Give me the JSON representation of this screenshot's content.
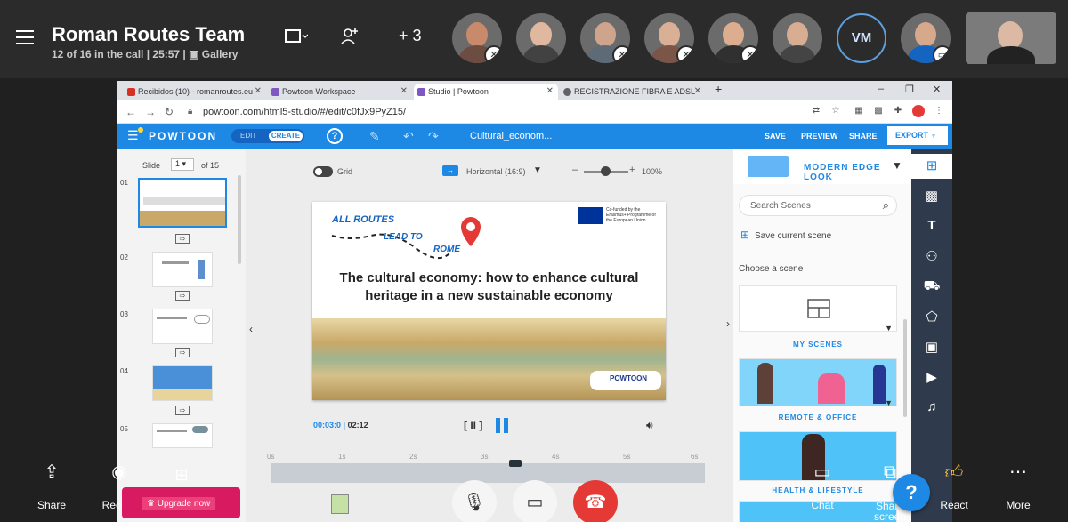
{
  "call": {
    "title": "Roman Routes Team",
    "info": "12 of 16 in the call | 25:57 | ▣ Gallery",
    "extra_participants": "+ 3",
    "initials_avatar": "VM"
  },
  "browser": {
    "tabs": [
      {
        "label": "Recibidos (10) - romanroutes.eu",
        "icon_color": "#d93025"
      },
      {
        "label": "Powtoon Workspace",
        "icon_color": "#7e57c2"
      },
      {
        "label": "Studio | Powtoon",
        "icon_color": "#7e57c2"
      },
      {
        "label": "REGISTRAZIONE FIBRA E ADSL",
        "icon_color": "#5f6368"
      }
    ],
    "url": "powtoon.com/html5-studio/#/edit/c0fJx9PyZ15/"
  },
  "powtoon": {
    "logo": "POWTOON",
    "edit_label": "EDIT",
    "create_label": "CREATE",
    "help": "?",
    "doc_title": "Cultural_econom...",
    "save": "SAVE",
    "preview": "PREVIEW",
    "share": "SHARE",
    "export": "EXPORT"
  },
  "slides": {
    "label": "Slide",
    "current": "1",
    "total": "of 15",
    "numbers": [
      "01",
      "02",
      "03",
      "04",
      "05"
    ]
  },
  "stage": {
    "grid_label": "Grid",
    "orientation": "Horizontal (16:9)",
    "zoom": "100%",
    "zoom_minus": "–",
    "zoom_plus": "+",
    "canvas_title_line1": "The cultural economy: how to enhance cultural",
    "canvas_title_line2": "heritage in a new sustainable economy",
    "logo_line1": "ALL ROUTES",
    "logo_line2": "LEAD TO",
    "logo_line3": "ROME",
    "eu_text": "Co-funded by the Erasmus+ Programme of the European Union",
    "badge": "POWTOON",
    "current_time": "00:03:0",
    "total_time": "02:12",
    "play_label": "[ II ]",
    "ruler": [
      "0s",
      "1s",
      "2s",
      "3s",
      "4s",
      "5s",
      "6s"
    ]
  },
  "right_panel": {
    "look": "MODERN EDGE LOOK",
    "search_placeholder": "Search Scenes",
    "save_scene": "Save current scene",
    "choose": "Choose a scene",
    "categories": [
      "MY SCENES",
      "REMOTE & OFFICE",
      "HEALTH & LIFESTYLE"
    ]
  },
  "bottom_bar": {
    "share": "Share",
    "record": "Record",
    "upgrade": "♛ Upgrade now",
    "chat": "Chat",
    "share_screen": "Share screen",
    "react": "React",
    "more": "More"
  },
  "colors": {
    "accent": "#1e88e5",
    "hangup": "#e53935",
    "upgrade": "#d81b60"
  }
}
